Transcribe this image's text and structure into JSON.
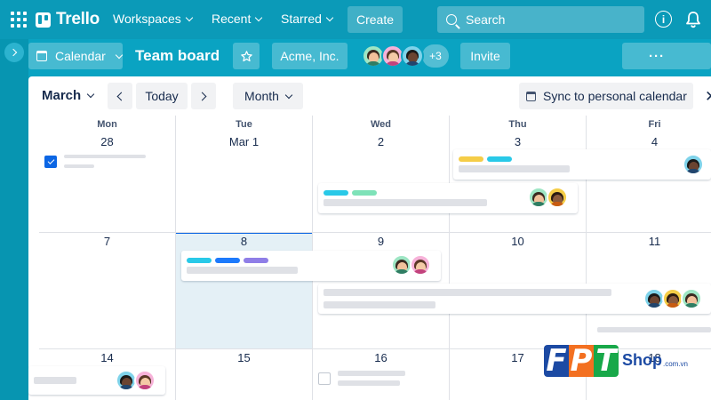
{
  "nav": {
    "logo": "Trello",
    "workspaces": "Workspaces",
    "recent": "Recent",
    "starred": "Starred",
    "create": "Create",
    "search_placeholder": "Search",
    "info_glyph": "i"
  },
  "board": {
    "view": "Calendar",
    "title": "Team board",
    "workspace": "Acme, Inc.",
    "member_overflow": "+3",
    "invite": "Invite",
    "more": "···"
  },
  "calendar": {
    "month": "March",
    "today": "Today",
    "range": "Month",
    "sync": "Sync to personal calendar",
    "close": "✕",
    "weekdays": [
      "Mon",
      "Tue",
      "Wed",
      "Thu",
      "Fri"
    ],
    "weeks": [
      [
        "28",
        "Mar 1",
        "2",
        "3",
        "4"
      ],
      [
        "7",
        "8",
        "9",
        "10",
        "11"
      ],
      [
        "14",
        "15",
        "16",
        "17",
        "18"
      ]
    ],
    "selected_day": "8"
  },
  "colors": {
    "accent": "#0aa3c2",
    "label_yellow": "#f5cd47",
    "label_cyan": "#29c9e8",
    "label_green": "#7ee2b8",
    "label_blue": "#1d7afc",
    "label_purple": "#8f7ee7",
    "check_blue": "#0c66e4"
  },
  "watermark": {
    "letters": [
      "F",
      "P",
      "T"
    ],
    "shop": "Shop",
    "domain": ".com.vn"
  }
}
